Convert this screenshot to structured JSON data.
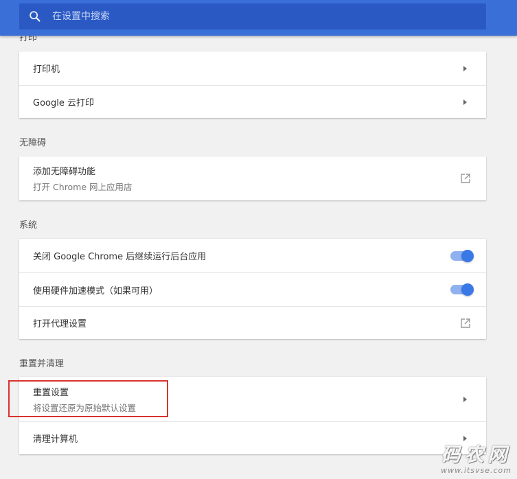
{
  "search": {
    "placeholder": "在设置中搜索"
  },
  "sections": {
    "print": {
      "title": "打印",
      "items": [
        {
          "label": "打印机"
        },
        {
          "label": "Google 云打印"
        }
      ]
    },
    "accessibility": {
      "title": "无障碍",
      "items": [
        {
          "label": "添加无障碍功能",
          "sub": "打开 Chrome 网上应用店"
        }
      ]
    },
    "system": {
      "title": "系统",
      "items": [
        {
          "label": "关闭 Google Chrome 后继续运行后台应用",
          "toggle": true
        },
        {
          "label": "使用硬件加速模式（如果可用）",
          "toggle": true
        },
        {
          "label": "打开代理设置"
        }
      ]
    },
    "reset": {
      "title": "重置并清理",
      "items": [
        {
          "label": "重置设置",
          "sub": "将设置还原为原始默认设置"
        },
        {
          "label": "清理计算机"
        }
      ]
    }
  },
  "watermark": {
    "text": "码农网",
    "url": "www.itsvse.com"
  },
  "colors": {
    "header": "#3b6fd8",
    "search_bg": "#2a59c4",
    "toggle_on": "#3b78e7",
    "highlight": "#d9322d"
  }
}
